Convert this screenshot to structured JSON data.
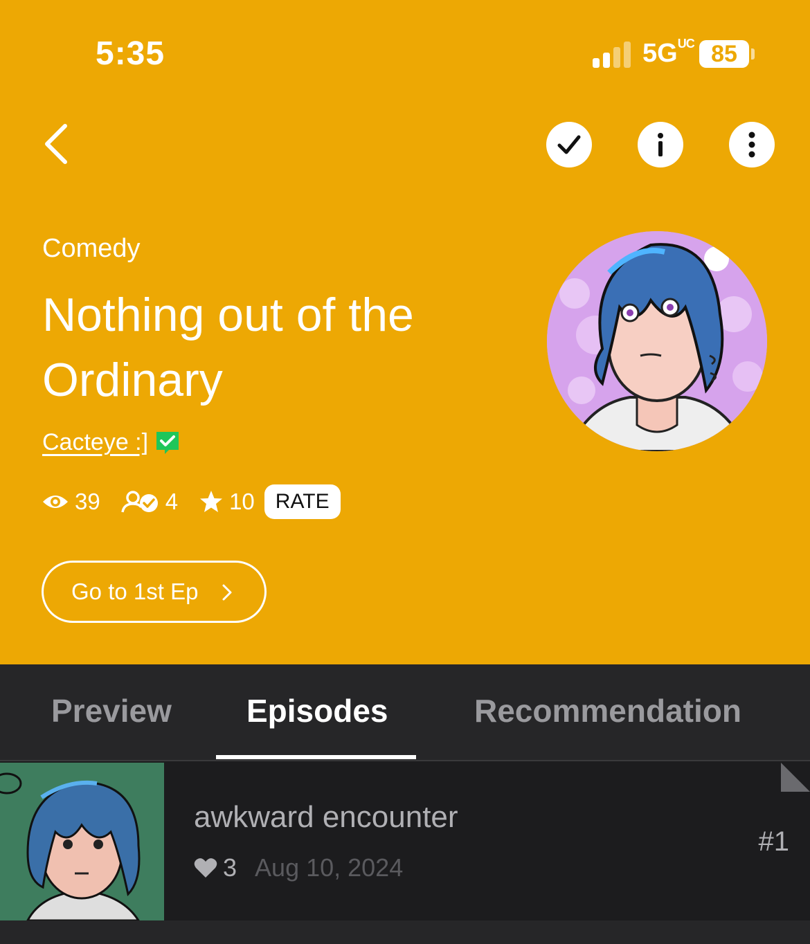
{
  "status_bar": {
    "time": "5:35",
    "network": "5G",
    "network_suffix": "UC",
    "battery": "85"
  },
  "nav": {
    "back_icon": "chevron-left-icon",
    "subscribe_icon": "check-icon",
    "info_icon": "info-icon",
    "more_icon": "more-vertical-icon"
  },
  "series": {
    "genre": "Comedy",
    "title": "Nothing out of the Ordinary",
    "author": "Cacteye :]",
    "stats": {
      "views": "39",
      "subscribers": "4",
      "rating": "10"
    },
    "rate_label": "RATE",
    "first_episode_label": "Go to 1st Ep"
  },
  "tabs": [
    {
      "label": "Preview"
    },
    {
      "label": "Episodes"
    },
    {
      "label": "Recommendation"
    }
  ],
  "episodes": [
    {
      "title": "awkward encounter",
      "likes": "3",
      "date": "Aug 10, 2024",
      "number": "#1"
    }
  ],
  "colors": {
    "hero": "#eda804",
    "background": "#1c1c1e",
    "tabbar": "#262628",
    "verified": "#1fc65a"
  }
}
